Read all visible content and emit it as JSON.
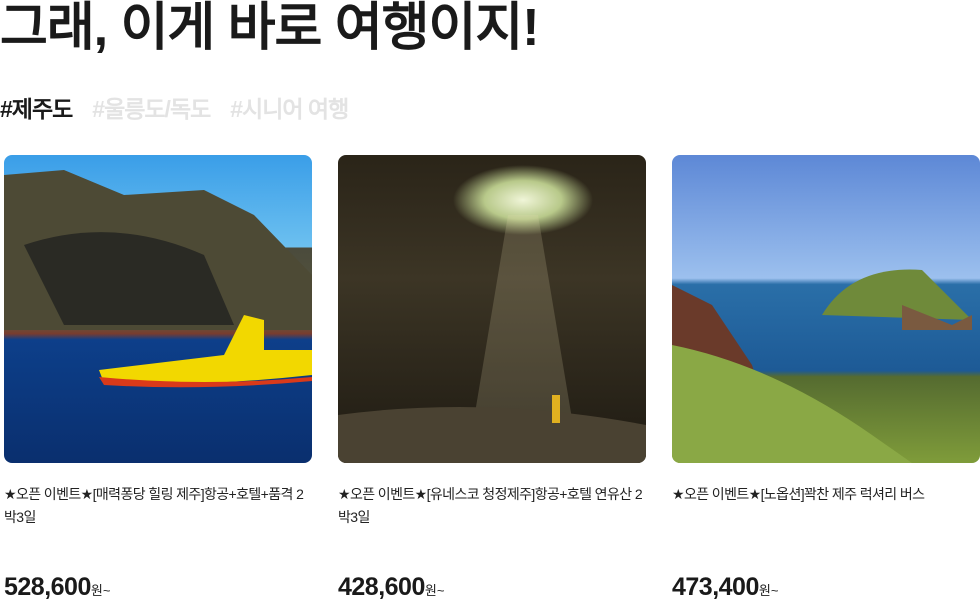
{
  "page_title": "그래, 이게 바로 여행이지!",
  "tabs": [
    {
      "label": "#제주도",
      "active": true
    },
    {
      "label": "#울릉도/독도",
      "active": false
    },
    {
      "label": "#시니어 여행",
      "active": false
    }
  ],
  "products": [
    {
      "title": "★오픈 이벤트★[매력퐁당 힐링 제주]항공+호텔+품격 2박3일",
      "price": "528,600",
      "unit": "원~"
    },
    {
      "title": "★오픈 이벤트★[유네스코 청정제주]항공+호텔 연유산 2박3일",
      "price": "428,600",
      "unit": "원~"
    },
    {
      "title": "★오픈 이벤트★[노옵션]꽉찬 제주 럭셔리 버스",
      "price": "473,400",
      "unit": "원~"
    }
  ]
}
